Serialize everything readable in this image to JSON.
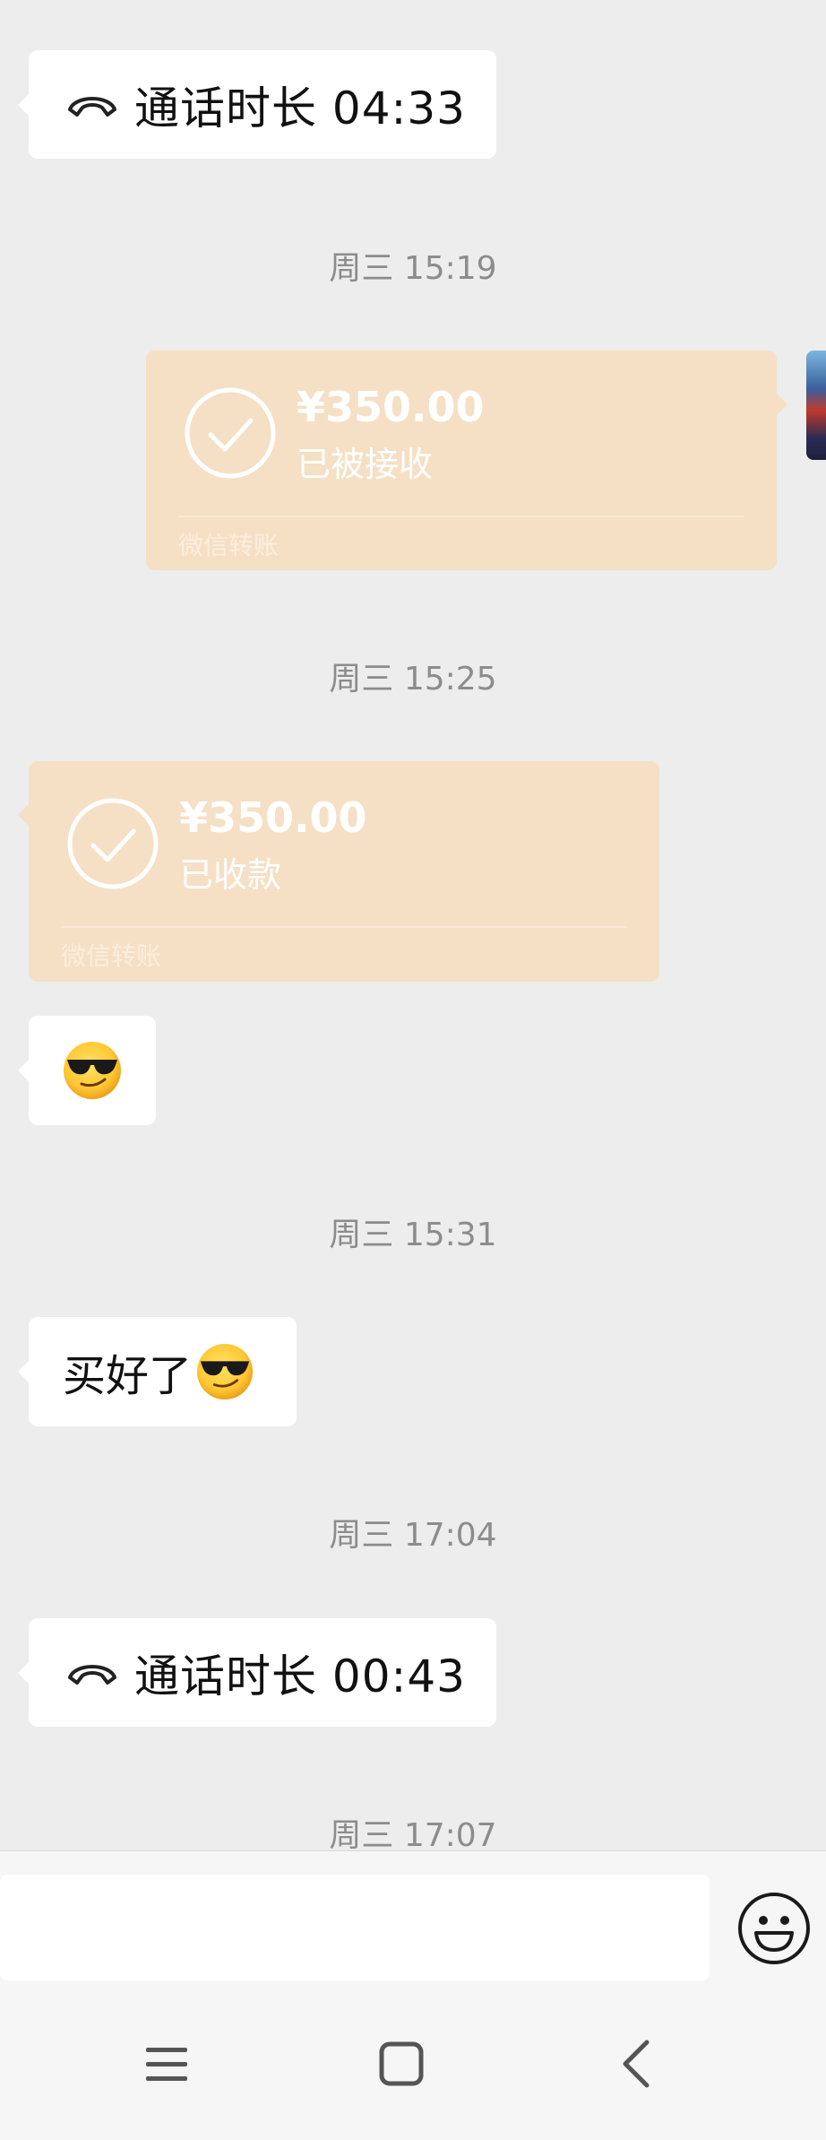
{
  "chat": {
    "messages": [
      {
        "type": "call",
        "side": "left",
        "text": "通话时长 04:33"
      },
      {
        "type": "time",
        "text": "周三 15:19"
      },
      {
        "type": "transfer",
        "side": "right",
        "amount": "¥350.00",
        "status": "已被接收",
        "label": "微信转账"
      },
      {
        "type": "time",
        "text": "周三 15:25"
      },
      {
        "type": "transfer",
        "side": "left",
        "amount": "¥350.00",
        "status": "已收款",
        "label": "微信转账"
      },
      {
        "type": "emoji",
        "side": "left",
        "emoji": "smiling-face-with-sunglasses"
      },
      {
        "type": "time",
        "text": "周三 15:31"
      },
      {
        "type": "text",
        "side": "left",
        "text": "买好了"
      },
      {
        "type": "time",
        "text": "周三 17:04"
      },
      {
        "type": "call",
        "side": "left",
        "text": "通话时长 00:43"
      },
      {
        "type": "time",
        "text": "周三 17:07"
      }
    ]
  },
  "input": {
    "placeholder": "",
    "emoji_icon": "smiley-face-icon"
  },
  "navbar": {
    "icons": [
      "menu-icon",
      "home-square-icon",
      "back-chevron-icon"
    ]
  },
  "colors": {
    "background": "#ededed",
    "bubble": "#ffffff",
    "transfer": "#f5e0c5",
    "timestamp": "#8c8c8c"
  }
}
